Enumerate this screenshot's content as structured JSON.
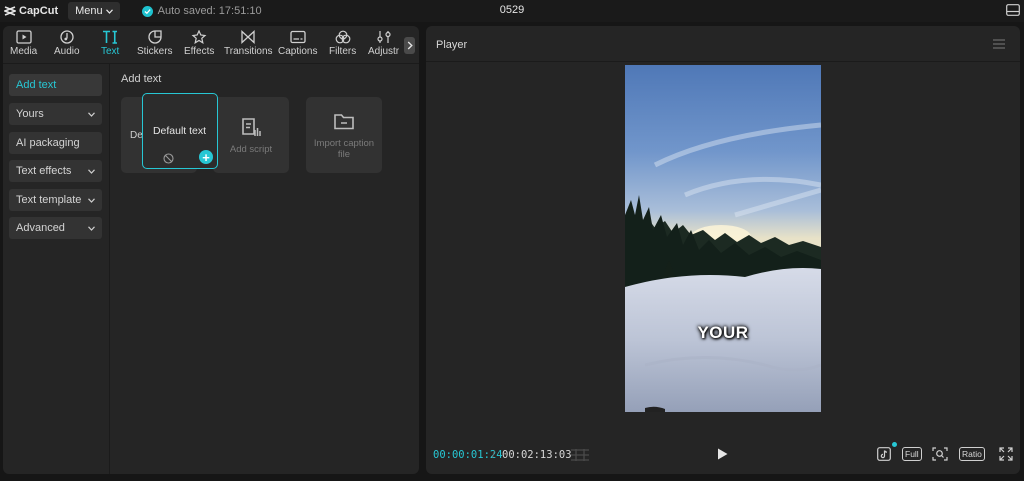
{
  "app": {
    "name": "CapCut",
    "menu_label": "Menu",
    "auto_saved": "Auto saved: 17:51:10",
    "project_title": "0529"
  },
  "tool_tabs": [
    {
      "label": "Media",
      "icon": "media-icon"
    },
    {
      "label": "Audio",
      "icon": "audio-icon"
    },
    {
      "label": "Text",
      "icon": "text-icon",
      "active": true
    },
    {
      "label": "Stickers",
      "icon": "sticker-icon"
    },
    {
      "label": "Effects",
      "icon": "effects-icon"
    },
    {
      "label": "Transitions",
      "icon": "transitions-icon"
    },
    {
      "label": "Captions",
      "icon": "captions-icon"
    },
    {
      "label": "Filters",
      "icon": "filters-icon"
    },
    {
      "label": "Adjustr",
      "icon": "adjust-icon"
    }
  ],
  "side_nav": [
    {
      "label": "Add text",
      "active": true
    },
    {
      "label": "Yours",
      "dropdown": true
    },
    {
      "label": "AI packaging"
    },
    {
      "label": "Text effects",
      "dropdown": true
    },
    {
      "label": "Text template",
      "dropdown": true
    },
    {
      "label": "Advanced",
      "dropdown": true
    }
  ],
  "content": {
    "section_title": "Add text",
    "cards": {
      "hidden_label": "De",
      "default_text": "Default text",
      "add_script": "Add script",
      "import_caption": "Import caption file"
    }
  },
  "player": {
    "title": "Player",
    "caption_text": "YOUR",
    "current_time": "00:00:01:24",
    "separator": "/",
    "total_time": "00:02:13:03",
    "full_label": "Full",
    "ratio_label": "Ratio"
  },
  "colors": {
    "accent": "#27c7d4",
    "panel": "#252525",
    "background": "#161616"
  }
}
